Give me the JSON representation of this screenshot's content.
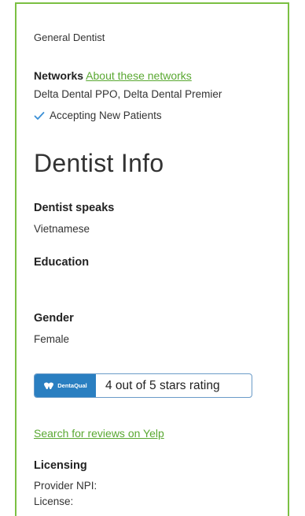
{
  "profile": {
    "specialty": "General Dentist",
    "networks_heading": "Networks",
    "networks_link": "About these networks",
    "networks_list": "Delta Dental PPO, Delta Dental Premier",
    "accepting_status": "Accepting New Patients"
  },
  "dentist_info": {
    "title": "Dentist Info",
    "languages_label": "Dentist speaks",
    "languages_value": "Vietnamese",
    "education_label": "Education",
    "education_value": "",
    "gender_label": "Gender",
    "gender_value": "Female"
  },
  "rating": {
    "logo_text": "DentaQual",
    "text": "4 out of 5 stars rating",
    "stars": 4,
    "max_stars": 5
  },
  "reviews": {
    "yelp_link": "Search for reviews on Yelp"
  },
  "licensing": {
    "label": "Licensing",
    "npi_label": "Provider NPI:",
    "license_label": "License:"
  },
  "colors": {
    "accent_green": "#5aa832",
    "frame_green": "#7bc043",
    "rating_blue": "#2a7fc1",
    "check_blue": "#3a8fd6"
  }
}
